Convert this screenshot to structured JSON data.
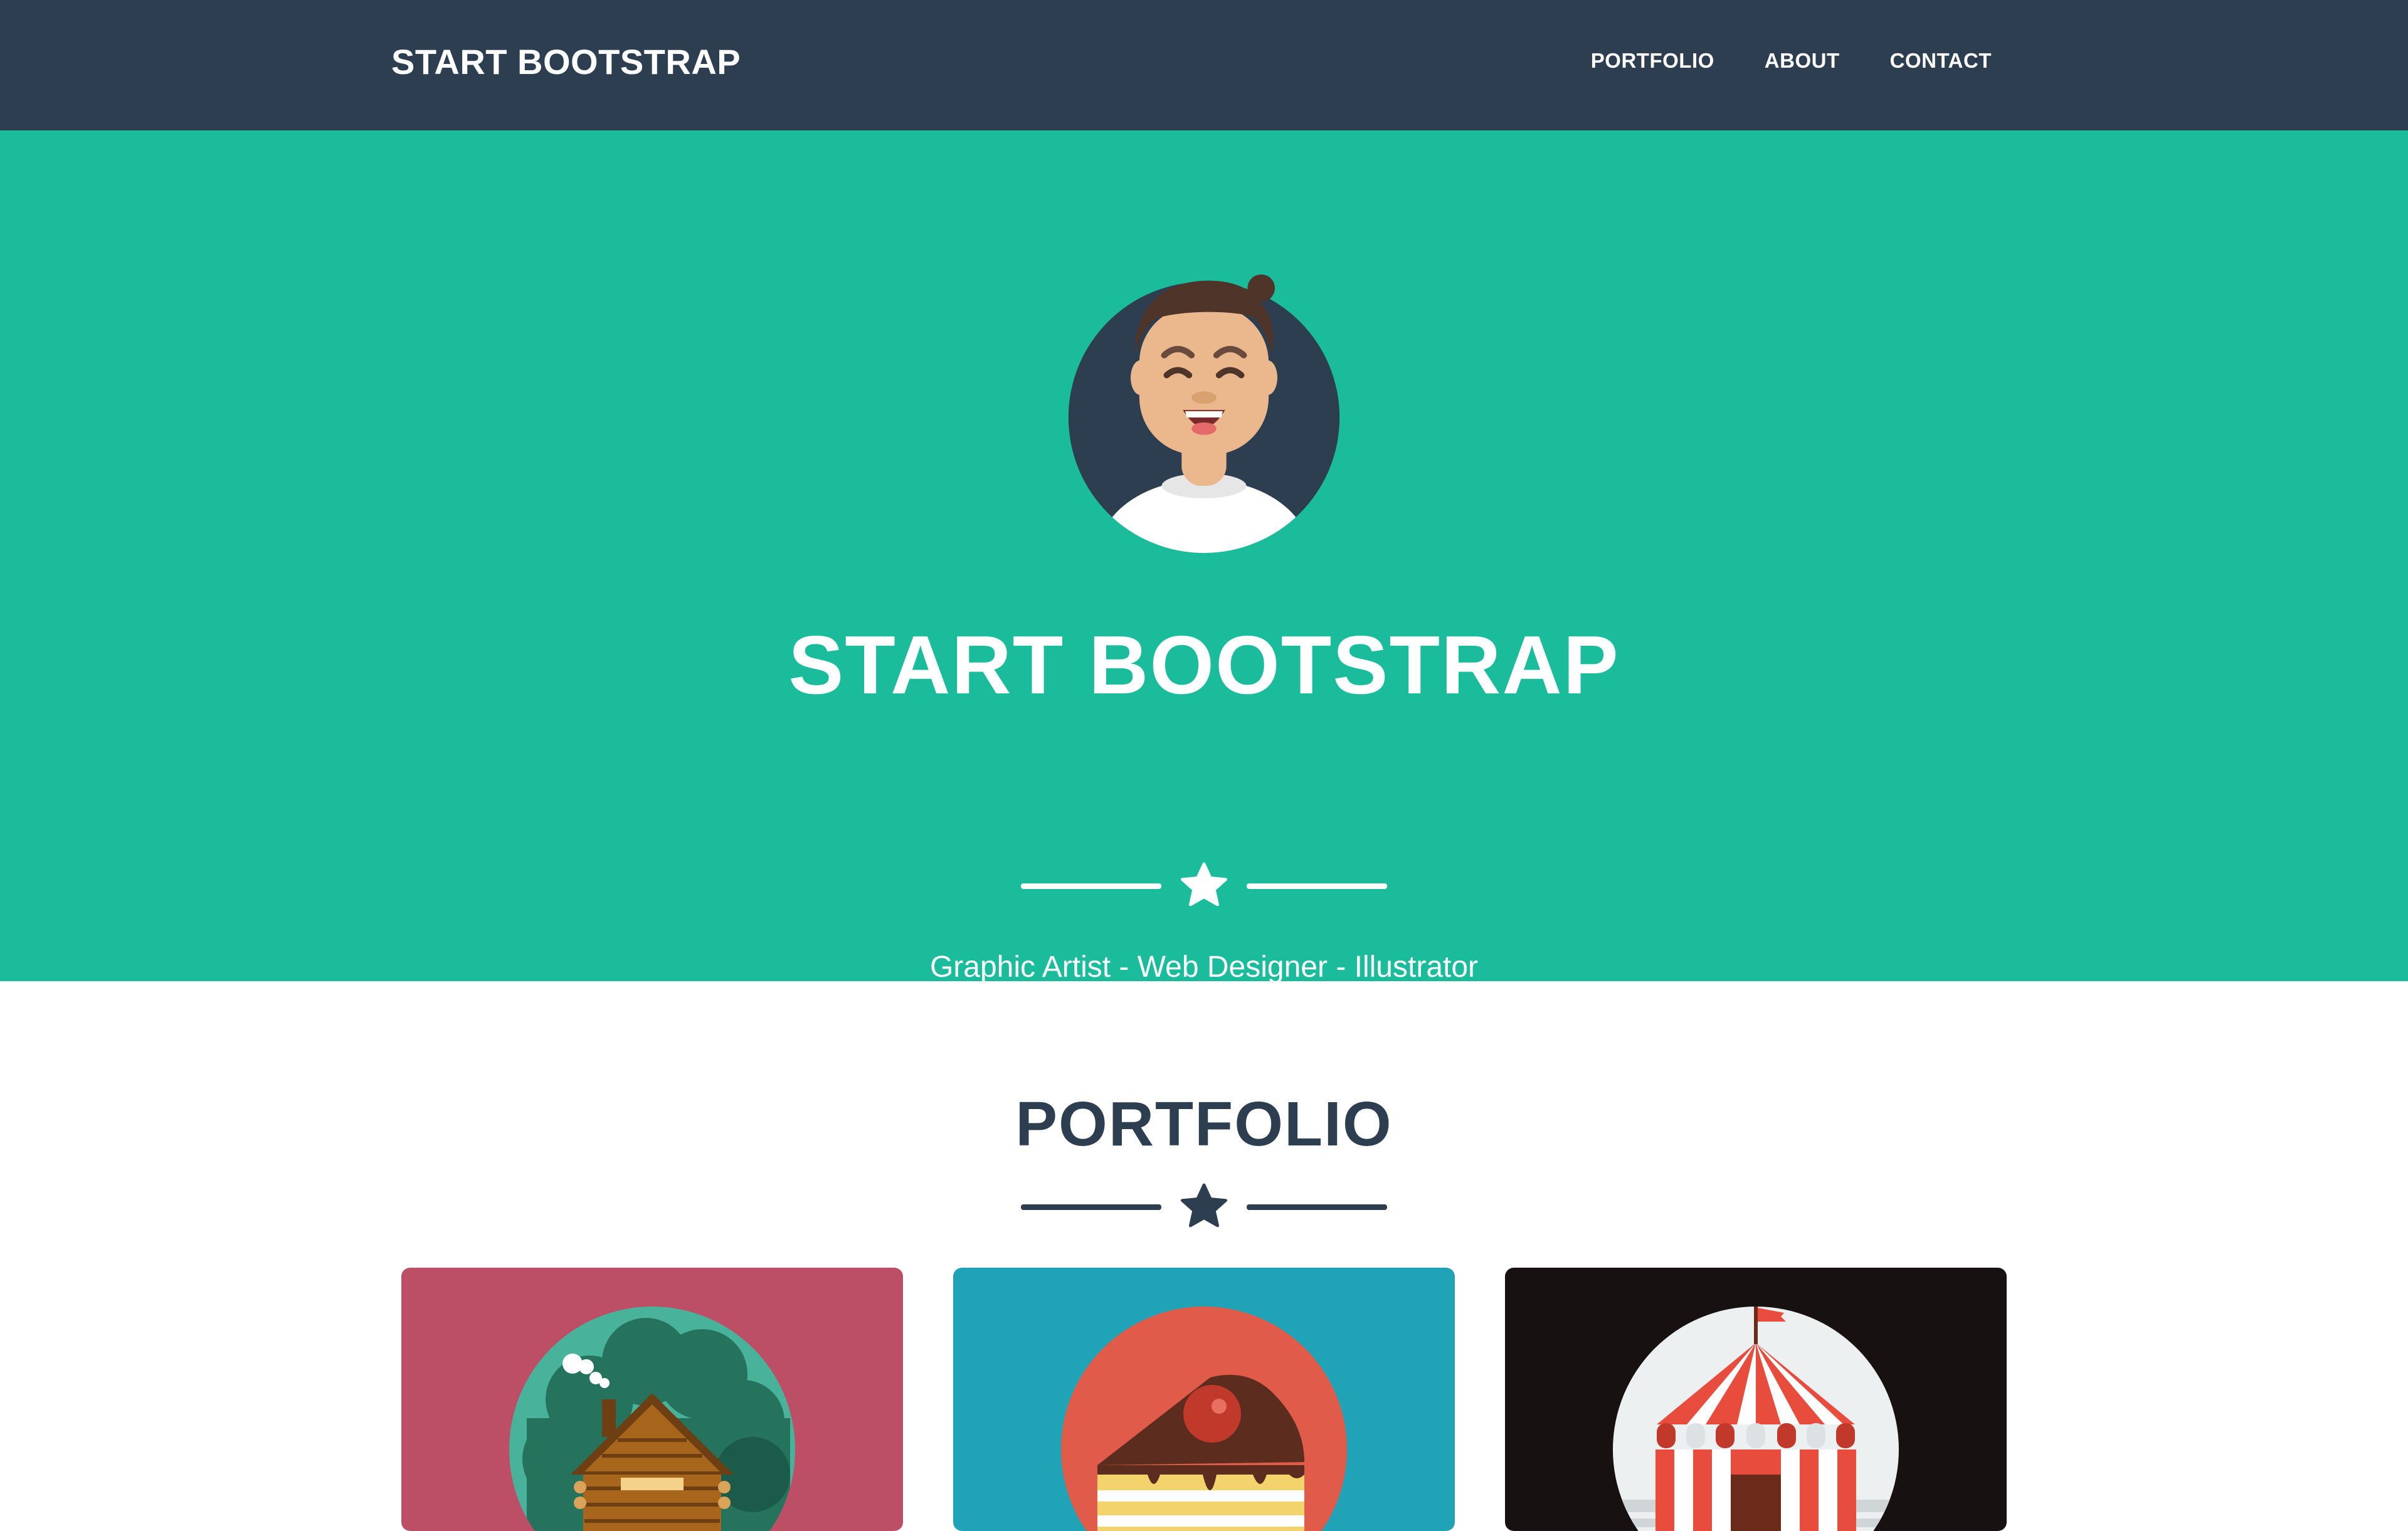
{
  "navbar": {
    "brand": "START BOOTSTRAP",
    "links": [
      {
        "label": "PORTFOLIO"
      },
      {
        "label": "ABOUT"
      },
      {
        "label": "CONTACT"
      }
    ]
  },
  "hero": {
    "title": "START BOOTSTRAP",
    "subtitle": "Graphic Artist - Web Designer - Illustrator",
    "avatar_icon": "avatar-icon",
    "divider_icon": "star-icon"
  },
  "portfolio": {
    "title": "PORTFOLIO",
    "divider_icon": "star-icon",
    "items": [
      {
        "name": "cabin",
        "background": "#bc4f65"
      },
      {
        "name": "cake",
        "background": "#20a3b6"
      },
      {
        "name": "circus",
        "background": "#171111"
      }
    ]
  },
  "colors": {
    "navbar": "#2c3e50",
    "hero": "#1abc9c",
    "text_dark": "#2c3e50",
    "text_light": "#ffffff"
  }
}
